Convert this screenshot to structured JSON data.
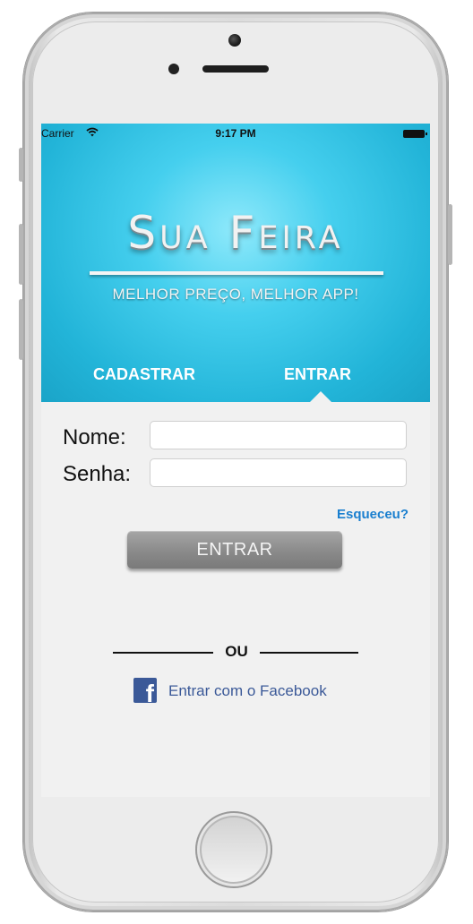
{
  "status_bar": {
    "carrier": "Carrier",
    "time": "9:17 PM",
    "wifi_icon": "wifi-icon",
    "battery_icon": "battery-icon"
  },
  "header": {
    "title": "Sua Feira",
    "subtitle": "MELHOR PREÇO, MELHOR APP!"
  },
  "tabs": [
    {
      "label": "CADASTRAR",
      "selected": false
    },
    {
      "label": "ENTRAR",
      "selected": true
    }
  ],
  "form": {
    "name_label": "Nome:",
    "name_value": "",
    "password_label": "Senha:",
    "password_value": "",
    "forgot_label": "Esqueceu?",
    "submit_label": "ENTRAR"
  },
  "divider": {
    "text": "OU"
  },
  "facebook": {
    "icon": "facebook-icon",
    "label": "Entrar com o Facebook"
  },
  "colors": {
    "header_blue": "#2ec0e4",
    "link_blue": "#1a7fcf",
    "facebook_blue": "#3b5998",
    "button_gray": "#8a8a8a"
  }
}
